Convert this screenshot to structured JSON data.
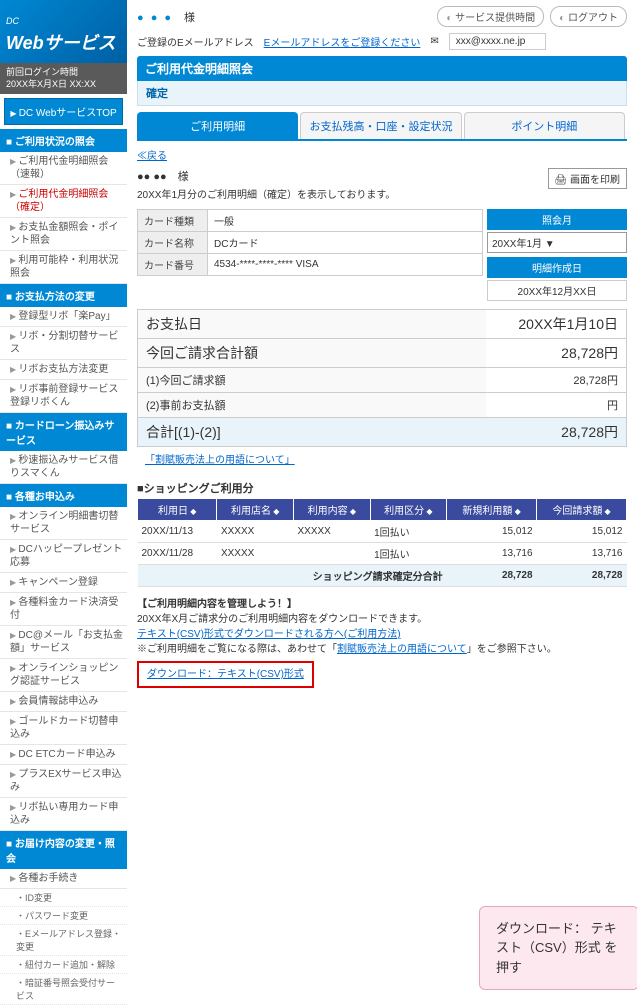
{
  "header": {
    "logo_dc": "DC",
    "logo_main": "Webサービス",
    "user_suffix": "様",
    "dots": "● ● ●",
    "service_hours": "サービス提供時間",
    "logout": "ログアウト",
    "email_label": "ご登録のEメールアドレス",
    "email_link": "Eメールアドレスをご登録ください",
    "email_value": "xxx@xxxx.ne.jp"
  },
  "login_info": {
    "label": "前回ログイン時間",
    "value": "20XX年X月X日 XX:XX"
  },
  "top_button": "DC WebサービスTOP",
  "sidebar": {
    "s1": {
      "title": "ご利用状況の照会",
      "items": [
        "ご利用代金明細照会（速報）",
        "ご利用代金明細照会（確定）",
        "お支払金額照会・ポイント照会",
        "利用可能枠・利用状況照会"
      ]
    },
    "s2": {
      "title": "お支払方法の変更",
      "items": [
        "登録型リボ「楽Pay」",
        "リボ・分割切替サービス",
        "リボお支払方法変更",
        "リボ事前登録サービス登録リボくん"
      ]
    },
    "s3": {
      "title": "カードローン振込みサービス",
      "items": [
        "秒速振込みサービス借りスマくん"
      ]
    },
    "s4": {
      "title": "各種お申込み",
      "items": [
        "オンライン明細書切替サービス",
        "DCハッピープレゼント応募",
        "キャンペーン登録",
        "各種料金カード決済受付",
        "DC@メール「お支払金額」サービス",
        "オンラインショッピング認証サービス",
        "会員情報誌申込み",
        "ゴールドカード切替申込み",
        "DC ETCカード申込み",
        "プラスEXサービス申込み",
        "リボ払い専用カード申込み"
      ]
    },
    "s5": {
      "title": "お届け内容の変更・照会",
      "items": [
        "各種お手続き"
      ],
      "subs": [
        "ID変更",
        "パスワード変更",
        "Eメールアドレス登録・変更",
        "紐付カード追加・解除",
        "暗証番号照会受付サービス"
      ]
    }
  },
  "page": {
    "title": "ご利用代金明細照会",
    "subtitle": "確定",
    "tabs": [
      "ご利用明細",
      "お支払残高・口座・設定状況",
      "ポイント明細"
    ],
    "back": "≪戻る",
    "greet_dots": "●● ●●",
    "greet_suffix": "様",
    "desc": "20XX年1月分のご利用明細（確定）を表示しております。",
    "print": "画面を印刷"
  },
  "card": {
    "rows": [
      {
        "k": "カード種類",
        "v": "一般"
      },
      {
        "k": "カード名称",
        "v": "DCカード"
      },
      {
        "k": "カード番号",
        "v": "4534-****-****-**** VISA"
      }
    ]
  },
  "month_panel": {
    "label1": "照会月",
    "select": "20XX年1月 ▼",
    "label2": "明細作成日",
    "date": "20XX年12月XX日"
  },
  "summary": {
    "r1": {
      "k": "お支払日",
      "v": "20XX年1月10日"
    },
    "r2": {
      "k": "今回ご請求合計額",
      "v": "28,728円"
    },
    "r3": {
      "k": "(1)今回ご請求額",
      "v": "28,728円"
    },
    "r4": {
      "k": "(2)事前お支払額",
      "v": "円"
    },
    "r5": {
      "k": "合計[(1)-(2)]",
      "v": "28,728円"
    },
    "note": "「割賦販売法上の用語について」"
  },
  "shopping": {
    "title": "ショッピングご利用分",
    "headers": [
      "利用日",
      "利用店名",
      "利用内容",
      "利用区分",
      "新規利用額",
      "今回請求額"
    ],
    "rows": [
      {
        "c": [
          "20XX/11/13",
          "XXXXX",
          "XXXXX",
          "1回払い",
          "15,012",
          "15,012"
        ]
      },
      {
        "c": [
          "20XX/11/28",
          "XXXXX",
          "",
          "1回払い",
          "13,716",
          "13,716"
        ]
      }
    ],
    "total_label": "ショッピング請求確定分合計",
    "total1": "28,728",
    "total2": "28,728"
  },
  "download": {
    "title": "【ご利用明細内容を管理しよう！】",
    "desc": "20XX年X月ご請求分のご利用明細内容をダウンロードできます。",
    "link1": "テキスト(CSV)形式でダウンロードされる方へ(ご利用方法)",
    "note_pre": "※ご利用明細をご覧になる際は、あわせて「",
    "note_link": "割賦販売法上の用語について",
    "note_post": "」をご参照下さい。",
    "button": "ダウンロード：テキスト(CSV)形式"
  },
  "callout": "ダウンロード：\nテキスト（CSV）形式\nを押す"
}
